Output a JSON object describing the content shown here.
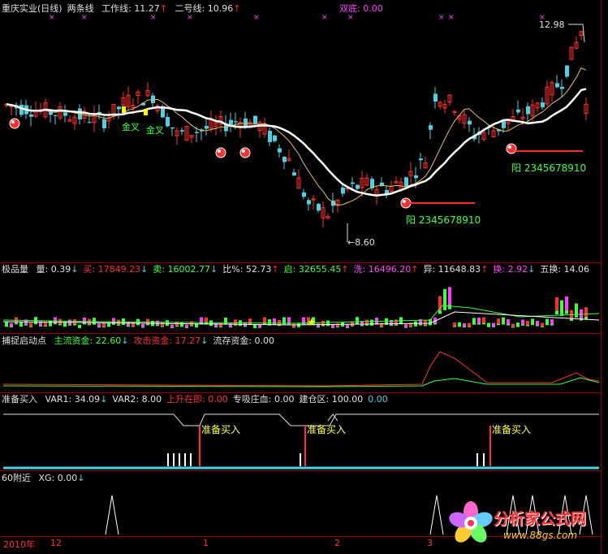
{
  "main": {
    "title": "重庆实业(日线)",
    "indicator": "两条线",
    "line1_label": "工作线:",
    "line1_value": "11.27",
    "line2_label": "二号线:",
    "line2_value": "10.96",
    "double_bottom_label": "双底:",
    "double_bottom_value": "0.00",
    "high_label": "12.98",
    "low_label": "8.60",
    "cross_label1": "金叉",
    "cross_label2": "金叉",
    "yang1": "阳 2345678910",
    "yang2": "阳 2345678910"
  },
  "vol": {
    "title": "极品量",
    "items": [
      {
        "label": "量:",
        "value": "0.39",
        "arrow": "↓",
        "color": "#e0e0e0"
      },
      {
        "label": "买:",
        "value": "17849.23",
        "arrow": "↓",
        "color": "#ff3030"
      },
      {
        "label": "卖:",
        "value": "16002.77",
        "arrow": "↓",
        "color": "#40ff40"
      },
      {
        "label": "比%:",
        "value": "52.73",
        "arrow": "↑",
        "color": "#e0e0e0"
      },
      {
        "label": "启:",
        "value": "32655.45",
        "arrow": "↑",
        "color": "#40ff40"
      },
      {
        "label": "洗:",
        "value": "16496.20",
        "arrow": "↑",
        "color": "#ff40ff"
      },
      {
        "label": "异:",
        "value": "11648.83",
        "arrow": "↑",
        "color": "#e0e0e0"
      },
      {
        "label": "换:",
        "value": "2.92",
        "arrow": "↓",
        "color": "#ff40ff"
      },
      {
        "label": "五换:",
        "value": "14.06",
        "arrow": "",
        "color": "#e0e0e0"
      }
    ]
  },
  "capture": {
    "title": "捕捉启动点",
    "items": [
      {
        "label": "主流资金:",
        "value": "22.60",
        "arrow": "↓",
        "color": "#40ff40"
      },
      {
        "label": "攻击资金:",
        "value": "17.27",
        "arrow": "↓",
        "color": "#ff3030"
      },
      {
        "label": "流存资金:",
        "value": "0.00",
        "arrow": "",
        "color": "#e0e0e0"
      }
    ]
  },
  "prep": {
    "title": "准备买入",
    "items": [
      {
        "label": "VAR1:",
        "value": "34.09",
        "arrow": "↓",
        "color": "#e0e0e0"
      },
      {
        "label": "VAR2:",
        "value": "8.00",
        "arrow": "",
        "color": "#e0e0e0"
      },
      {
        "label": "上升在即:",
        "value": "0.00",
        "arrow": "",
        "color": "#ff3030"
      },
      {
        "label": "专吸庄血:",
        "value": "0.00",
        "arrow": "",
        "color": "#e0e0e0"
      },
      {
        "label": "建仓区:",
        "value": "100.00",
        "arrow": "",
        "color": "#e0e0e0"
      },
      {
        "label": "",
        "value": "0.00",
        "arrow": "",
        "color": "#4dd0e1"
      }
    ],
    "signal": "准备买入"
  },
  "near60": {
    "title": "60附近",
    "items": [
      {
        "label": "XG:",
        "value": "0.00",
        "arrow": "↓",
        "color": "#e0e0e0"
      }
    ]
  },
  "dates": {
    "year": "2010年",
    "m12": "12",
    "m1": "1",
    "m2": "2",
    "m3": "3"
  },
  "logo": {
    "text": "分析家公式网",
    "url": "www.88gs.com"
  },
  "colors": {
    "up": "#ff3030",
    "down": "#4dd0e1",
    "border": "#8b0000"
  }
}
